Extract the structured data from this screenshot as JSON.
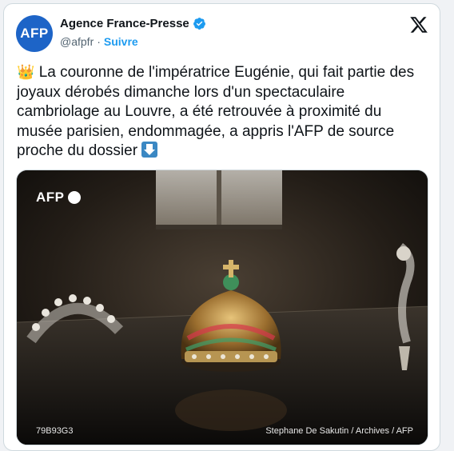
{
  "author": {
    "avatar_text": "AFP",
    "name": "Agence France-Presse",
    "handle": "@afpfr",
    "separator": "·",
    "follow_label": "Suivre"
  },
  "tweet": {
    "crown_emoji": "👑",
    "text": "La couronne de l'impératrice Eugénie, qui fait partie des joyaux dérobés dimanche lors d'un spectaculaire cambriolage au Louvre, a été retrouvée à proximité du musée parisien, endommagée, a appris l'AFP de source proche du dossier"
  },
  "media": {
    "watermark": "AFP",
    "code": "79B93G3",
    "credit": "Stephane De Sakutin / Archives / AFP"
  },
  "colors": {
    "accent": "#1d9bf0",
    "avatar": "#1d64c7",
    "border": "#cfd9de"
  },
  "icons": [
    "verified-badge-icon",
    "x-logo-icon",
    "crown-emoji-icon",
    "down-arrow-emoji-icon"
  ]
}
